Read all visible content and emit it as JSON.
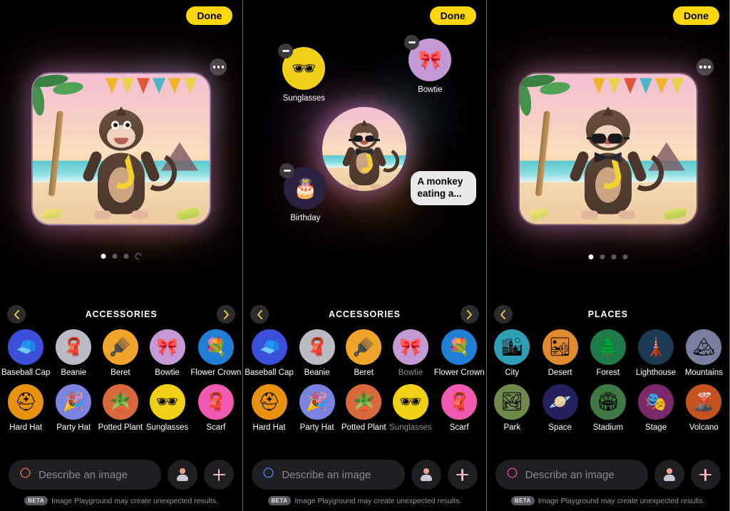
{
  "panels": [
    {
      "id": "panel-base-image",
      "done_label": "Done",
      "more_icon": "more-options-icon",
      "dots": [
        "active",
        "inactive",
        "inactive",
        "refresh"
      ],
      "category": {
        "title": "ACCESSORIES",
        "prev_icon": "chevron-left-icon",
        "next_icon": "chevron-right-icon",
        "has_next": true,
        "items": [
          {
            "label": "Baseball Cap",
            "icon": "baseball-cap-icon",
            "glyph": "🧢",
            "bg": "#3b4fd8",
            "selected": false
          },
          {
            "label": "Beanie",
            "icon": "beanie-icon",
            "glyph": "🧣",
            "bg": "#b9bcc4",
            "selected": false
          },
          {
            "label": "Beret",
            "icon": "beret-icon",
            "glyph": "🪮",
            "bg": "#f0a52a",
            "selected": false
          },
          {
            "label": "Bowtie",
            "icon": "bowtie-icon",
            "glyph": "🎀",
            "bg": "#c49ad6",
            "selected": false
          },
          {
            "label": "Flower Crown",
            "icon": "flower-crown-icon",
            "glyph": "💐",
            "bg": "#1f7fd4",
            "selected": false
          },
          {
            "label": "Hard Hat",
            "icon": "hard-hat-icon",
            "glyph": "⛑",
            "bg": "#e8920f",
            "selected": false
          },
          {
            "label": "Party Hat",
            "icon": "party-hat-icon",
            "glyph": "🎉",
            "bg": "#7a84e0",
            "selected": false
          },
          {
            "label": "Potted Plant",
            "icon": "potted-plant-icon",
            "glyph": "🪴",
            "bg": "#d9683c",
            "selected": false
          },
          {
            "label": "Sunglasses",
            "icon": "sunglasses-icon",
            "glyph": "🕶",
            "bg": "#f0d117",
            "selected": false
          },
          {
            "label": "Scarf",
            "icon": "scarf-icon",
            "glyph": "🧣",
            "bg": "#f05ab0",
            "selected": false
          }
        ]
      },
      "input": {
        "placeholder": "Describe an image",
        "value": "",
        "sparkle_icon": "sparkle-icon",
        "sparkle_color": "#e8604a",
        "person_icon": "person-icon",
        "add_icon": "plus-icon"
      },
      "disclaimer": {
        "badge": "BETA",
        "text": "Image Playground may create unexpected results."
      }
    },
    {
      "id": "panel-concepts",
      "done_label": "Done",
      "concepts": [
        {
          "label": "Sunglasses",
          "icon": "sunglasses-concept-icon",
          "glyph": "🕶",
          "bg": "#f0d117",
          "remove_icon": "minus-icon"
        },
        {
          "label": "Bowtie",
          "icon": "bowtie-concept-icon",
          "glyph": "🎀",
          "bg": "#c49ad6",
          "remove_icon": "minus-icon"
        },
        {
          "label": "Birthday",
          "icon": "birthday-concept-icon",
          "glyph": "🎂",
          "bg": "#2a2340",
          "remove_icon": "minus-icon"
        }
      ],
      "text_concept": {
        "text": "A monkey eating a...",
        "remove_icon": "minus-icon"
      },
      "category": {
        "title": "ACCESSORIES",
        "prev_icon": "chevron-left-icon",
        "next_icon": "chevron-right-icon",
        "has_next": true,
        "items": [
          {
            "label": "Baseball Cap",
            "icon": "baseball-cap-icon",
            "glyph": "🧢",
            "bg": "#3b4fd8",
            "selected": false
          },
          {
            "label": "Beanie",
            "icon": "beanie-icon",
            "glyph": "🧣",
            "bg": "#b9bcc4",
            "selected": false
          },
          {
            "label": "Beret",
            "icon": "beret-icon",
            "glyph": "🪮",
            "bg": "#f0a52a",
            "selected": false
          },
          {
            "label": "Bowtie",
            "icon": "bowtie-icon",
            "glyph": "🎀",
            "bg": "#c49ad6",
            "selected": true
          },
          {
            "label": "Flower Crown",
            "icon": "flower-crown-icon",
            "glyph": "💐",
            "bg": "#1f7fd4",
            "selected": false
          },
          {
            "label": "Hard Hat",
            "icon": "hard-hat-icon",
            "glyph": "⛑",
            "bg": "#e8920f",
            "selected": false
          },
          {
            "label": "Party Hat",
            "icon": "party-hat-icon",
            "glyph": "🎉",
            "bg": "#7a84e0",
            "selected": false
          },
          {
            "label": "Potted Plant",
            "icon": "potted-plant-icon",
            "glyph": "🪴",
            "bg": "#d9683c",
            "selected": false
          },
          {
            "label": "Sunglasses",
            "icon": "sunglasses-icon",
            "glyph": "🕶",
            "bg": "#f0d117",
            "selected": true
          },
          {
            "label": "Scarf",
            "icon": "scarf-icon",
            "glyph": "🧣",
            "bg": "#f05ab0",
            "selected": false
          }
        ]
      },
      "input": {
        "placeholder": "Describe an image",
        "value": "",
        "sparkle_icon": "sparkle-icon",
        "sparkle_color": "#4a7fe8",
        "person_icon": "person-icon",
        "add_icon": "plus-icon"
      },
      "disclaimer": {
        "badge": "BETA",
        "text": "Image Playground may create unexpected results."
      }
    },
    {
      "id": "panel-result-image",
      "done_label": "Done",
      "more_icon": "more-options-icon",
      "dots": [
        "active",
        "inactive",
        "inactive",
        "inactive"
      ],
      "category": {
        "title": "PLACES",
        "prev_icon": "chevron-left-icon",
        "next_icon": "chevron-right-icon",
        "has_next": false,
        "items": [
          {
            "label": "City",
            "icon": "city-icon",
            "glyph": "🏙",
            "bg": "#2f9fb5",
            "selected": false
          },
          {
            "label": "Desert",
            "icon": "desert-icon",
            "glyph": "🏜",
            "bg": "#e08a30",
            "selected": false
          },
          {
            "label": "Forest",
            "icon": "forest-icon",
            "glyph": "🌲",
            "bg": "#1f7a4a",
            "selected": false
          },
          {
            "label": "Lighthouse",
            "icon": "lighthouse-icon",
            "glyph": "🗼",
            "bg": "#1d3a55",
            "selected": false
          },
          {
            "label": "Mountains",
            "icon": "mountains-icon",
            "glyph": "🏔",
            "bg": "#7a7fa0",
            "selected": false
          },
          {
            "label": "Park",
            "icon": "park-icon",
            "glyph": "🏞",
            "bg": "#6e8a4a",
            "selected": false
          },
          {
            "label": "Space",
            "icon": "space-icon",
            "glyph": "🪐",
            "bg": "#24205c",
            "selected": false
          },
          {
            "label": "Stadium",
            "icon": "stadium-icon",
            "glyph": "🏟",
            "bg": "#3f7a45",
            "selected": false
          },
          {
            "label": "Stage",
            "icon": "stage-icon",
            "glyph": "🎭",
            "bg": "#7a2a6a",
            "selected": false
          },
          {
            "label": "Volcano",
            "icon": "volcano-icon",
            "glyph": "🌋",
            "bg": "#c4531f",
            "selected": false
          }
        ]
      },
      "input": {
        "placeholder": "Describe an image",
        "value": "",
        "sparkle_icon": "sparkle-icon",
        "sparkle_color": "#d84a7a",
        "person_icon": "person-icon",
        "add_icon": "plus-icon"
      },
      "disclaimer": {
        "badge": "BETA",
        "text": "Image Playground may create unexpected results."
      }
    }
  ],
  "theme": {
    "accent": "#FFD60A",
    "background": "#000000",
    "chip_bg": "#1f1f21",
    "label": "#ffffff",
    "label_dim": "#8e8e93"
  }
}
